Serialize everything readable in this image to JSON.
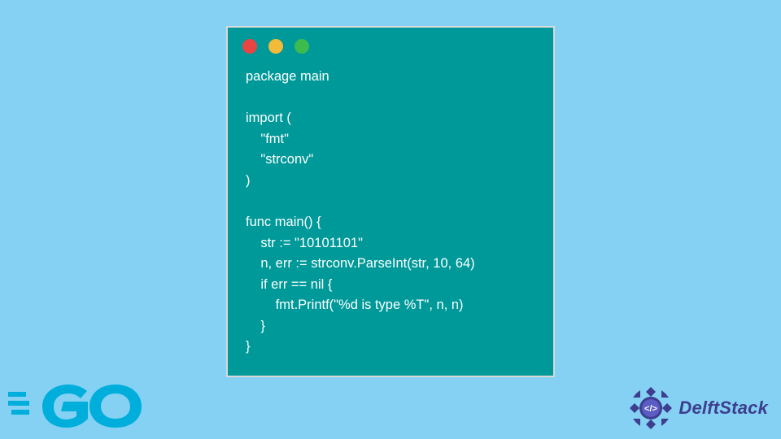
{
  "window": {
    "dots": [
      "red",
      "yellow",
      "green"
    ]
  },
  "code": {
    "lines": [
      "package main",
      "",
      "import (",
      "    \"fmt\"",
      "    \"strconv\"",
      ")",
      "",
      "func main() {",
      "    str := \"10101101\"",
      "    n, err := strconv.ParseInt(str, 10, 64)",
      "    if err == nil {",
      "        fmt.Printf(\"%d is type %T\", n, n)",
      "    }",
      "}"
    ]
  },
  "logos": {
    "go": "GO",
    "delft": "DelftStack"
  },
  "colors": {
    "background": "#84d1f4",
    "window": "#009999",
    "border": "#d9d9d9",
    "go_logo": "#00aedb",
    "delft": "#3d3e8e"
  }
}
